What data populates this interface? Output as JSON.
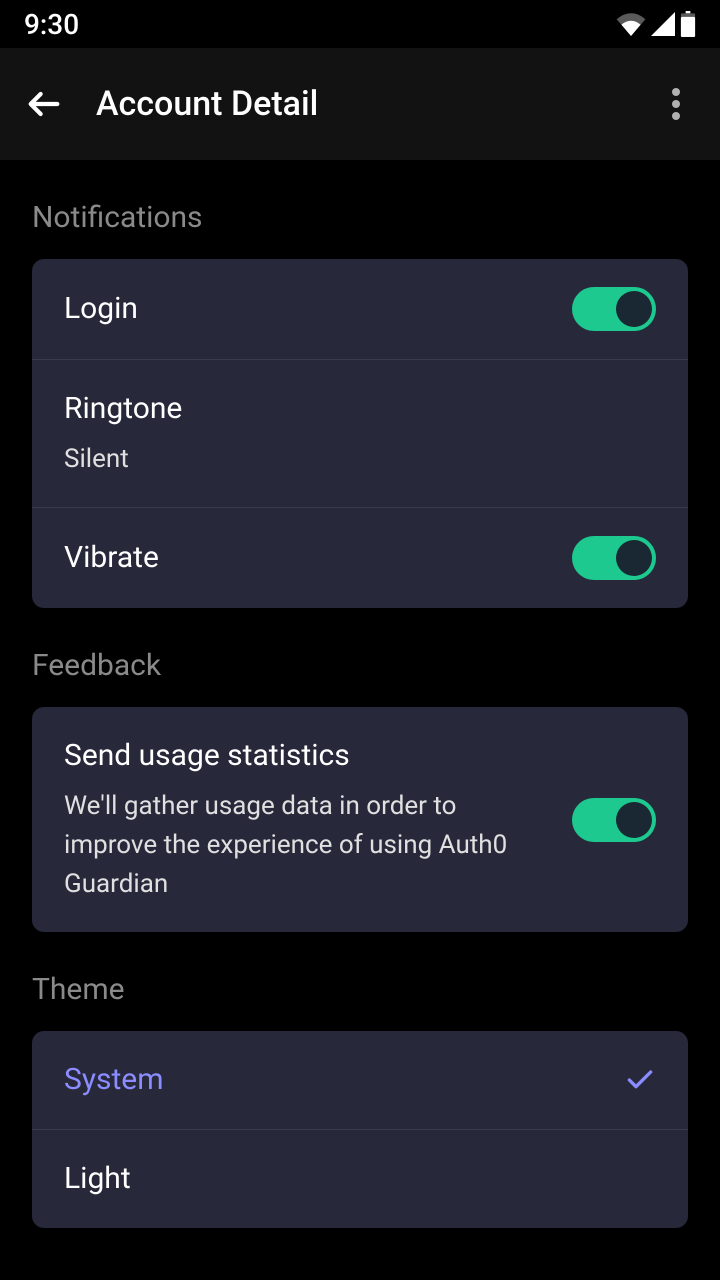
{
  "statusBar": {
    "time": "9:30"
  },
  "appBar": {
    "title": "Account Detail"
  },
  "sections": {
    "notifications": {
      "header": "Notifications",
      "items": {
        "login": {
          "title": "Login"
        },
        "ringtone": {
          "title": "Ringtone",
          "subtitle": "Silent"
        },
        "vibrate": {
          "title": "Vibrate"
        }
      }
    },
    "feedback": {
      "header": "Feedback",
      "items": {
        "usage": {
          "title": "Send usage statistics",
          "subtitle": "We'll gather usage data in order to improve the experience of using Auth0 Guardian"
        }
      }
    },
    "theme": {
      "header": "Theme",
      "items": {
        "system": {
          "title": "System"
        },
        "light": {
          "title": "Light"
        }
      }
    }
  }
}
